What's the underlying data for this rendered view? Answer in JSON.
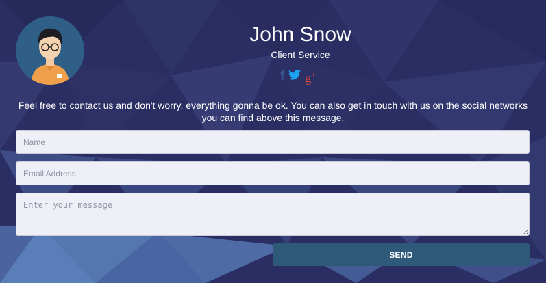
{
  "profile": {
    "name": "John Snow",
    "role": "Client Service"
  },
  "social": [
    {
      "name": "facebook",
      "icon": "facebook-icon",
      "color": "#3b5998"
    },
    {
      "name": "twitter",
      "icon": "twitter-icon",
      "color": "#1da1f2"
    },
    {
      "name": "google-plus",
      "icon": "google-plus-icon",
      "color": "#dd4b39"
    }
  ],
  "message": "Feel free to contact us and don't worry, everything gonna be ok. You can also get in touch with us on the social networks you can find above this message.",
  "form": {
    "name_placeholder": "Name",
    "email_placeholder": "Email Address",
    "message_placeholder": "Enter your message",
    "send_label": "SEND"
  },
  "colors": {
    "send_button": "#2e5978",
    "field_bg": "#eff0f7"
  }
}
